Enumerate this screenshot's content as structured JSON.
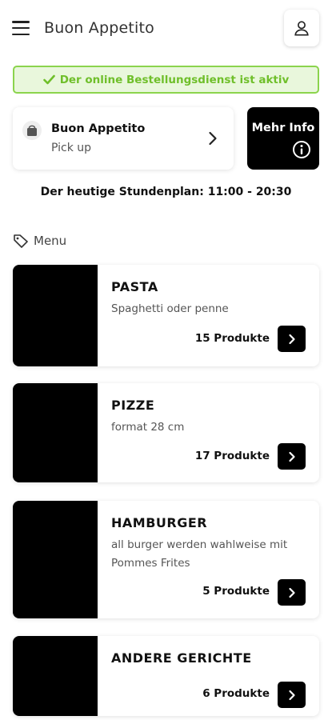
{
  "header": {
    "title": "Buon Appetito",
    "menu_icon": "hamburger-menu-icon",
    "user_icon": "user-icon"
  },
  "status": {
    "text": "Der online Bestellungsdienst ist aktiv",
    "icon": "checkmark-icon",
    "color": "#6fbf2a"
  },
  "store": {
    "name": "Buon Appetito",
    "mode": "Pick up",
    "icon": "shopping-bag-icon"
  },
  "info_button": {
    "label": "Mehr Info",
    "icon": "info-icon"
  },
  "schedule": "Der heutige Stundenplan: 11:00 - 20:30",
  "menu": {
    "label": "Menu",
    "icon": "tag-icon",
    "categories": [
      {
        "title": "PASTA",
        "description": "Spaghetti oder penne",
        "count": "15 Produkte"
      },
      {
        "title": "PIZZE",
        "description": "format 28 cm",
        "count": "17 Produkte"
      },
      {
        "title": "HAMBURGER",
        "description": "all burger werden wahlweise mit Pommes Frites",
        "count": "5 Produkte"
      },
      {
        "title": "ANDERE GERICHTE",
        "description": "",
        "count": "6 Produkte"
      }
    ]
  }
}
